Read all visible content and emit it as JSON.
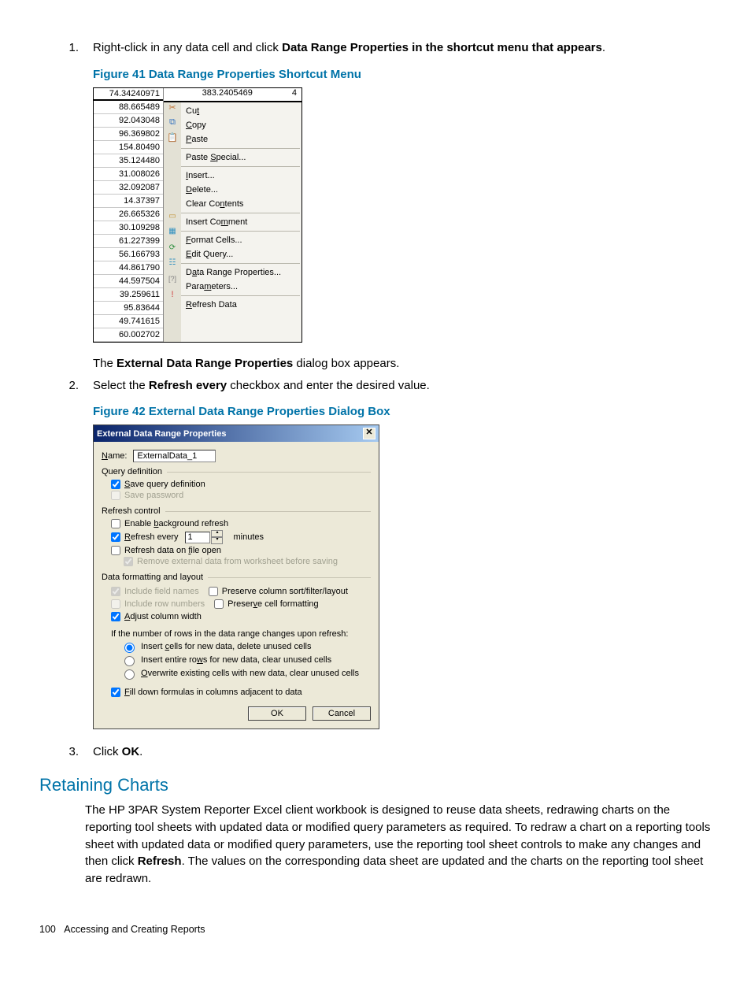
{
  "steps": {
    "s1_num": "1.",
    "s1_pre": "Right-click in any data cell and click ",
    "s1_bold": "Data Range Properties in the shortcut menu that appears",
    "s1_post": ".",
    "s1a": "The ",
    "s1a_bold": "External Data Range Properties",
    "s1a_post": " dialog box appears.",
    "s2_num": "2.",
    "s2_pre": "Select the ",
    "s2_bold": "Refresh every",
    "s2_post": " checkbox and enter the desired value.",
    "s3_num": "3.",
    "s3_pre": "Click ",
    "s3_bold": "OK",
    "s3_post": "."
  },
  "captions": {
    "fig41": "Figure 41 Data Range Properties Shortcut Menu",
    "fig42": "Figure 42 External Data Range Properties Dialog Box"
  },
  "fig41": {
    "hdr1": "74.34240971",
    "hdr2": "383.2405469",
    "hdr3": "4",
    "cells": {
      "c1": "88.665489",
      "c2": "92.043048",
      "c3": "96.369802",
      "c4": "154.80490",
      "c5": "35.124480",
      "c6": "31.008026",
      "c7": "32.092087",
      "c8": "14.37397",
      "c9": "26.665326",
      "c10": "30.109298",
      "c11": "61.227399",
      "c12": "56.166793",
      "c13": "44.861790",
      "c14": "44.597504",
      "c15": "39.259611",
      "c16": "95.83644",
      "c17": "49.741615",
      "c18": "60.002702"
    },
    "menu": {
      "cut": "Cut",
      "copy": "Copy",
      "paste": "Paste",
      "paste_special": "Paste Special...",
      "insert": "Insert...",
      "delete": "Delete...",
      "clear": "Clear Contents",
      "comment": "Insert Comment",
      "format": "Format Cells...",
      "edit_query": "Edit Query...",
      "data_range": "Data Range Properties...",
      "parameters": "Parameters...",
      "refresh": "Refresh Data"
    }
  },
  "fig42": {
    "title": "External Data Range Properties",
    "name_label": "Name:",
    "name_value": "ExternalData_1",
    "grp_query": "Query definition",
    "save_query": "Save query definition",
    "save_pw": "Save password",
    "grp_refresh": "Refresh control",
    "bg_refresh": "Enable background refresh",
    "refresh_every": "Refresh every",
    "refresh_val": "1",
    "minutes": "minutes",
    "refresh_file": "Refresh data on file open",
    "remove_ext": "Remove external data from worksheet before saving",
    "grp_layout": "Data formatting and layout",
    "inc_fields": "Include field names",
    "inc_rows": "Include row numbers",
    "adjust": "Adjust column width",
    "preserve_sort": "Preserve column sort/filter/layout",
    "preserve_cell": "Preserve cell formatting",
    "rows_change": "If the number of rows in the data range changes upon refresh:",
    "r1": "Insert cells for new data, delete unused cells",
    "r2": "Insert entire rows for new data, clear unused cells",
    "r3": "Overwrite existing cells with new data, clear unused cells",
    "fill": "Fill down formulas in columns adjacent to data",
    "ok": "OK",
    "cancel": "Cancel"
  },
  "section": {
    "title": "Retaining Charts",
    "p1a": "The HP 3PAR System Reporter Excel client workbook is designed to reuse data sheets, redrawing charts on the reporting tool sheets with updated data or modified query parameters as required. To redraw a chart on a reporting tools sheet with updated data or modified query parameters, use the reporting tool sheet controls to make any changes and then click ",
    "p1b": "Refresh",
    "p1c": ". The values on the corresponding data sheet are updated and the charts on the reporting tool sheet are redrawn."
  },
  "footer": {
    "page": "100",
    "title": "Accessing and Creating Reports"
  }
}
